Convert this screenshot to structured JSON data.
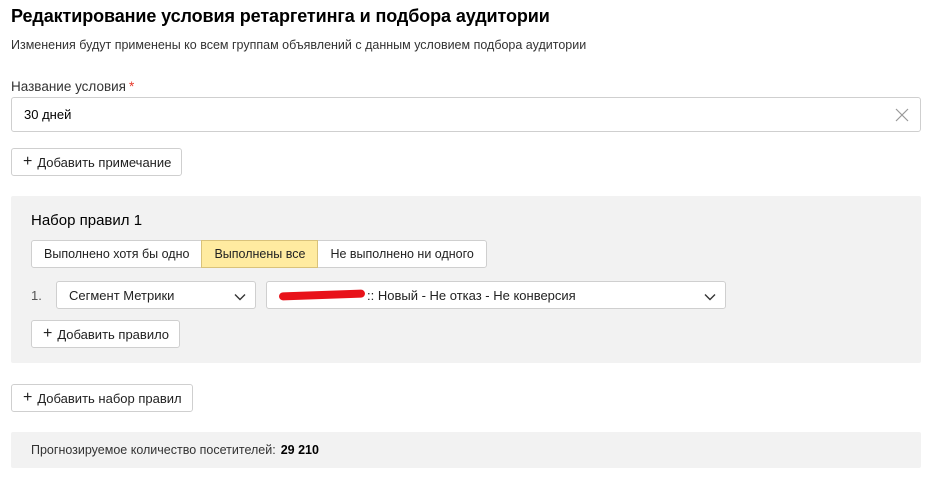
{
  "header": {
    "title": "Редактирование условия ретаргетинга и подбора аудитории",
    "subtitle": "Изменения будут применены ко всем группам объявлений с данным условием подбора аудитории"
  },
  "condition_name": {
    "label": "Название условия",
    "required_mark": "*",
    "value": "30 дней",
    "clear_icon": "close-icon"
  },
  "add_note_button": {
    "label": "Добавить примечание",
    "icon": "plus-icon"
  },
  "rule_set": {
    "title": "Набор правил 1",
    "match_options": [
      "Выполнено хотя бы одно",
      "Выполнены все",
      "Не выполнено ни одного"
    ],
    "selected_option": "Выполнены все",
    "rules": [
      {
        "number": "1.",
        "type": "Сегмент Метрики",
        "segment_value": ":: Новый - Не отказ - Не конверсия"
      }
    ],
    "add_rule_button": "Добавить правило"
  },
  "add_rule_set_button": "Добавить набор правил",
  "forecast": {
    "label": "Прогнозируемое количество посетителей:",
    "value": "29 210"
  },
  "colors": {
    "active_option_bg": "#ffeba0",
    "panel_bg": "#f2f2f2",
    "required": "#e63a2c",
    "redaction": "#e8121a"
  }
}
